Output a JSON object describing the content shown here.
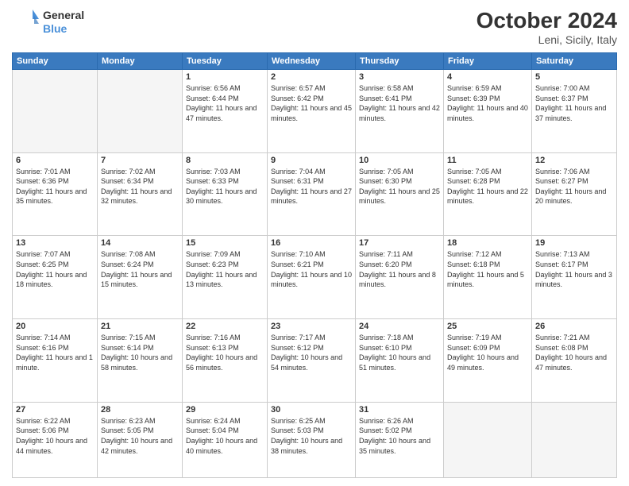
{
  "header": {
    "logo_general": "General",
    "logo_blue": "Blue",
    "month": "October 2024",
    "location": "Leni, Sicily, Italy"
  },
  "weekdays": [
    "Sunday",
    "Monday",
    "Tuesday",
    "Wednesday",
    "Thursday",
    "Friday",
    "Saturday"
  ],
  "weeks": [
    [
      {
        "day": "",
        "info": ""
      },
      {
        "day": "",
        "info": ""
      },
      {
        "day": "1",
        "info": "Sunrise: 6:56 AM\nSunset: 6:44 PM\nDaylight: 11 hours and 47 minutes."
      },
      {
        "day": "2",
        "info": "Sunrise: 6:57 AM\nSunset: 6:42 PM\nDaylight: 11 hours and 45 minutes."
      },
      {
        "day": "3",
        "info": "Sunrise: 6:58 AM\nSunset: 6:41 PM\nDaylight: 11 hours and 42 minutes."
      },
      {
        "day": "4",
        "info": "Sunrise: 6:59 AM\nSunset: 6:39 PM\nDaylight: 11 hours and 40 minutes."
      },
      {
        "day": "5",
        "info": "Sunrise: 7:00 AM\nSunset: 6:37 PM\nDaylight: 11 hours and 37 minutes."
      }
    ],
    [
      {
        "day": "6",
        "info": "Sunrise: 7:01 AM\nSunset: 6:36 PM\nDaylight: 11 hours and 35 minutes."
      },
      {
        "day": "7",
        "info": "Sunrise: 7:02 AM\nSunset: 6:34 PM\nDaylight: 11 hours and 32 minutes."
      },
      {
        "day": "8",
        "info": "Sunrise: 7:03 AM\nSunset: 6:33 PM\nDaylight: 11 hours and 30 minutes."
      },
      {
        "day": "9",
        "info": "Sunrise: 7:04 AM\nSunset: 6:31 PM\nDaylight: 11 hours and 27 minutes."
      },
      {
        "day": "10",
        "info": "Sunrise: 7:05 AM\nSunset: 6:30 PM\nDaylight: 11 hours and 25 minutes."
      },
      {
        "day": "11",
        "info": "Sunrise: 7:05 AM\nSunset: 6:28 PM\nDaylight: 11 hours and 22 minutes."
      },
      {
        "day": "12",
        "info": "Sunrise: 7:06 AM\nSunset: 6:27 PM\nDaylight: 11 hours and 20 minutes."
      }
    ],
    [
      {
        "day": "13",
        "info": "Sunrise: 7:07 AM\nSunset: 6:25 PM\nDaylight: 11 hours and 18 minutes."
      },
      {
        "day": "14",
        "info": "Sunrise: 7:08 AM\nSunset: 6:24 PM\nDaylight: 11 hours and 15 minutes."
      },
      {
        "day": "15",
        "info": "Sunrise: 7:09 AM\nSunset: 6:23 PM\nDaylight: 11 hours and 13 minutes."
      },
      {
        "day": "16",
        "info": "Sunrise: 7:10 AM\nSunset: 6:21 PM\nDaylight: 11 hours and 10 minutes."
      },
      {
        "day": "17",
        "info": "Sunrise: 7:11 AM\nSunset: 6:20 PM\nDaylight: 11 hours and 8 minutes."
      },
      {
        "day": "18",
        "info": "Sunrise: 7:12 AM\nSunset: 6:18 PM\nDaylight: 11 hours and 5 minutes."
      },
      {
        "day": "19",
        "info": "Sunrise: 7:13 AM\nSunset: 6:17 PM\nDaylight: 11 hours and 3 minutes."
      }
    ],
    [
      {
        "day": "20",
        "info": "Sunrise: 7:14 AM\nSunset: 6:16 PM\nDaylight: 11 hours and 1 minute."
      },
      {
        "day": "21",
        "info": "Sunrise: 7:15 AM\nSunset: 6:14 PM\nDaylight: 10 hours and 58 minutes."
      },
      {
        "day": "22",
        "info": "Sunrise: 7:16 AM\nSunset: 6:13 PM\nDaylight: 10 hours and 56 minutes."
      },
      {
        "day": "23",
        "info": "Sunrise: 7:17 AM\nSunset: 6:12 PM\nDaylight: 10 hours and 54 minutes."
      },
      {
        "day": "24",
        "info": "Sunrise: 7:18 AM\nSunset: 6:10 PM\nDaylight: 10 hours and 51 minutes."
      },
      {
        "day": "25",
        "info": "Sunrise: 7:19 AM\nSunset: 6:09 PM\nDaylight: 10 hours and 49 minutes."
      },
      {
        "day": "26",
        "info": "Sunrise: 7:21 AM\nSunset: 6:08 PM\nDaylight: 10 hours and 47 minutes."
      }
    ],
    [
      {
        "day": "27",
        "info": "Sunrise: 6:22 AM\nSunset: 5:06 PM\nDaylight: 10 hours and 44 minutes."
      },
      {
        "day": "28",
        "info": "Sunrise: 6:23 AM\nSunset: 5:05 PM\nDaylight: 10 hours and 42 minutes."
      },
      {
        "day": "29",
        "info": "Sunrise: 6:24 AM\nSunset: 5:04 PM\nDaylight: 10 hours and 40 minutes."
      },
      {
        "day": "30",
        "info": "Sunrise: 6:25 AM\nSunset: 5:03 PM\nDaylight: 10 hours and 38 minutes."
      },
      {
        "day": "31",
        "info": "Sunrise: 6:26 AM\nSunset: 5:02 PM\nDaylight: 10 hours and 35 minutes."
      },
      {
        "day": "",
        "info": ""
      },
      {
        "day": "",
        "info": ""
      }
    ]
  ]
}
